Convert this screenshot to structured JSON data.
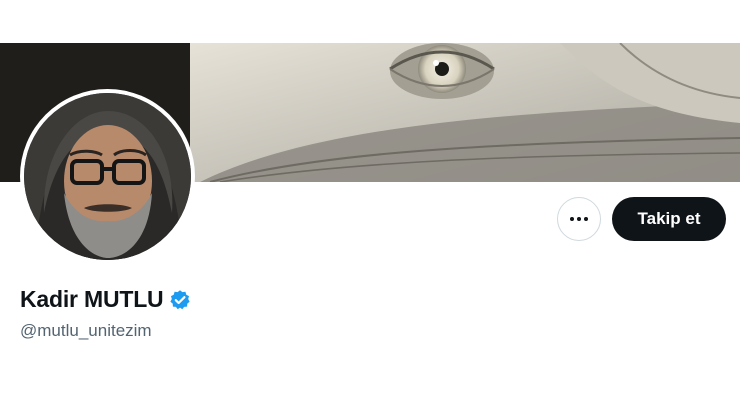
{
  "profile": {
    "display_name": "Kadir MUTLU",
    "handle": "@mutlu_unitezim",
    "verified": true
  },
  "actions": {
    "more_icon": "more-dots-icon",
    "follow_label": "Takip et"
  },
  "colors": {
    "follow_button_bg": "#0f1419",
    "verified_badge": "#1d9bf0",
    "handle_text": "#536471"
  }
}
